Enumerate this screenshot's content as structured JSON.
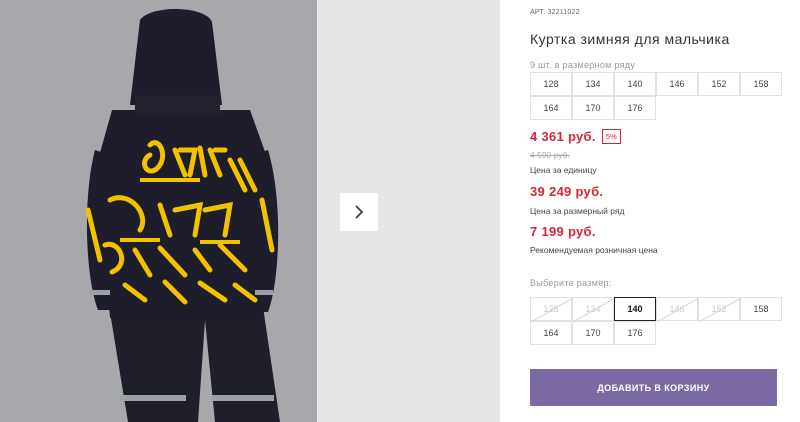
{
  "product": {
    "article_label": "АРТ.",
    "article": "32211022",
    "title": "Куртка зимняя для мальчика",
    "range_note": "9 шт. в размерном ряду",
    "range_sizes": [
      "128",
      "134",
      "140",
      "146",
      "152",
      "158",
      "164",
      "170",
      "176"
    ]
  },
  "prices": {
    "unit_price": "4 361 руб.",
    "discount": "5%",
    "old_price": "4 590 руб.",
    "unit_label": "Цена за единицу",
    "range_price": "39 249 руб.",
    "range_label": "Цена за размерный ряд",
    "retail_price": "7 199 руб.",
    "retail_label": "Рекомендуемая розничная цена"
  },
  "size_select": {
    "label": "Выберите размер:",
    "options": [
      {
        "size": "128",
        "state": "disabled"
      },
      {
        "size": "134",
        "state": "disabled"
      },
      {
        "size": "140",
        "state": "selected"
      },
      {
        "size": "146",
        "state": "disabled"
      },
      {
        "size": "152",
        "state": "disabled"
      },
      {
        "size": "158",
        "state": "available"
      },
      {
        "size": "164",
        "state": "available"
      },
      {
        "size": "170",
        "state": "available"
      },
      {
        "size": "176",
        "state": "available"
      }
    ]
  },
  "cart_button": {
    "label": "ДОБАВИТЬ В КОРЗИНУ"
  },
  "gallery": {
    "next_icon": "chevron-right-icon"
  },
  "colors": {
    "accent_red": "#d2263b",
    "button_purple": "#7b6aa3",
    "jacket_yellow": "#f2c100",
    "jacket_dark": "#1d1d2b"
  }
}
